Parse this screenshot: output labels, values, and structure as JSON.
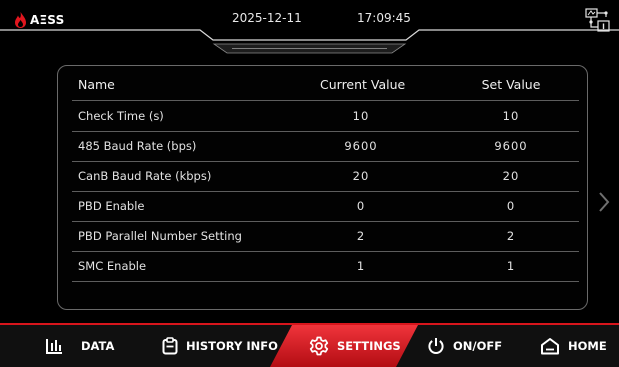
{
  "header": {
    "brand": "AΞSS",
    "date": "2025-12-11",
    "time": "17:09:45"
  },
  "table": {
    "columns": [
      "Name",
      "Current Value",
      "Set Value"
    ],
    "rows": [
      {
        "name": "Check Time (s)",
        "current": "10",
        "set": "10"
      },
      {
        "name": "485 Baud Rate (bps)",
        "current": "9600",
        "set": "9600"
      },
      {
        "name": "CanB Baud Rate (kbps)",
        "current": "20",
        "set": "20"
      },
      {
        "name": "PBD Enable",
        "current": "0",
        "set": "0"
      },
      {
        "name": "PBD Parallel Number Setting",
        "current": "2",
        "set": "2"
      },
      {
        "name": "SMC Enable",
        "current": "1",
        "set": "1"
      }
    ]
  },
  "nav": {
    "items": [
      {
        "label": "DATA",
        "icon": "bar-chart-icon"
      },
      {
        "label": "HISTORY INFO",
        "icon": "clipboard-icon"
      },
      {
        "label": "SETTINGS",
        "icon": "gear-icon",
        "active": true
      },
      {
        "label": "ON/OFF",
        "icon": "power-icon"
      },
      {
        "label": "HOME",
        "icon": "home-icon"
      }
    ]
  },
  "colors": {
    "accent": "#d8151c",
    "background": "#000000",
    "panel_border": "#6a6a6a"
  }
}
